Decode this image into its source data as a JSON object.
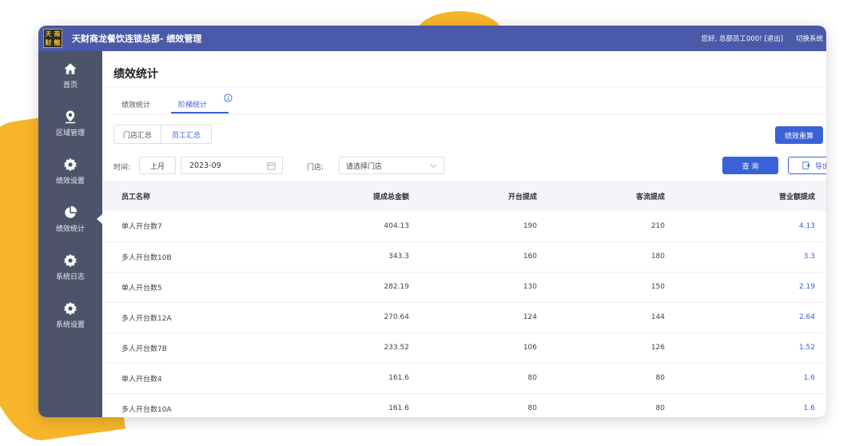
{
  "app": {
    "logo_chars": [
      "天",
      "商",
      "财",
      "龍"
    ],
    "title": "天财商龙餐饮连锁总部- 绩效管理",
    "greeting": "您好, 总部员工000!",
    "logout": "[退出]",
    "switch_system": "切换系统"
  },
  "sidebar": {
    "items": [
      {
        "label": "首页",
        "icon": "home-icon"
      },
      {
        "label": "区域管理",
        "icon": "map-pin-icon"
      },
      {
        "label": "绩效设置",
        "icon": "gear-icon"
      },
      {
        "label": "绩效统计",
        "icon": "pie-chart-icon",
        "active": true
      },
      {
        "label": "系统日志",
        "icon": "gear-icon"
      },
      {
        "label": "系统设置",
        "icon": "gear-icon"
      }
    ]
  },
  "page": {
    "title": "绩效统计",
    "tabs": [
      {
        "label": "绩效统计"
      },
      {
        "label": "阶梯统计",
        "active": true
      }
    ],
    "segments": [
      {
        "label": "门店汇总"
      },
      {
        "label": "员工汇总",
        "active": true
      }
    ],
    "recalc_button": "绩效重算"
  },
  "filters": {
    "time_label": "时间:",
    "month_button": "上月",
    "date_value": "2023-09",
    "store_label": "门店:",
    "store_placeholder": "请选择门店",
    "query_button": "查 询",
    "export_button": "导出"
  },
  "table": {
    "columns": [
      "员工名称",
      "提成总金额",
      "开台提成",
      "客流提成",
      "营业额提成"
    ],
    "rows": [
      [
        "单人开台数7",
        "404.13",
        "190",
        "210",
        "4.13"
      ],
      [
        "多人开台数10B",
        "343.3",
        "160",
        "180",
        "3.3"
      ],
      [
        "单人开台数5",
        "282.19",
        "130",
        "150",
        "2.19"
      ],
      [
        "多人开台数12A",
        "270.64",
        "124",
        "144",
        "2.64"
      ],
      [
        "多人开台数7B",
        "233.52",
        "106",
        "126",
        "1.52"
      ],
      [
        "单人开台数4",
        "161.6",
        "80",
        "80",
        "1.6"
      ],
      [
        "多人开台数10A",
        "161.6",
        "80",
        "80",
        "1.6"
      ]
    ]
  },
  "colors": {
    "topbar": "#4a5aa8",
    "sidebar": "#4b5468",
    "accent": "#3a62d8",
    "background_blob": "#f7b52a"
  }
}
